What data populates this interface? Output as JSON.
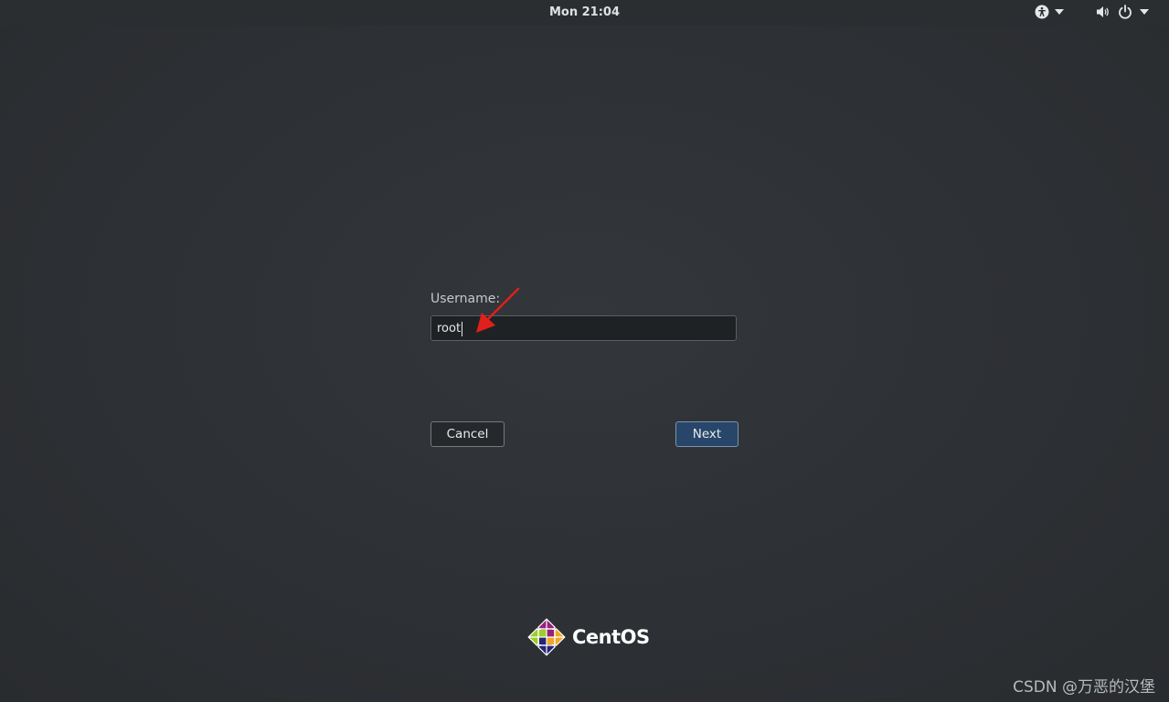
{
  "topbar": {
    "clock": "Mon 21:04",
    "icons": [
      "accessibility-icon",
      "chevron-down-icon",
      "volume-icon",
      "power-icon",
      "chevron-down-icon"
    ]
  },
  "login": {
    "username_label": "Username:",
    "username_value": "root",
    "cancel_label": "Cancel",
    "next_label": "Next"
  },
  "branding": {
    "logo_text": "CentOS"
  },
  "watermark": "CSDN @万恶的汉堡",
  "colors": {
    "background": "#2d3033",
    "next_button": "#27466a",
    "annotation_arrow": "#e0201a"
  }
}
